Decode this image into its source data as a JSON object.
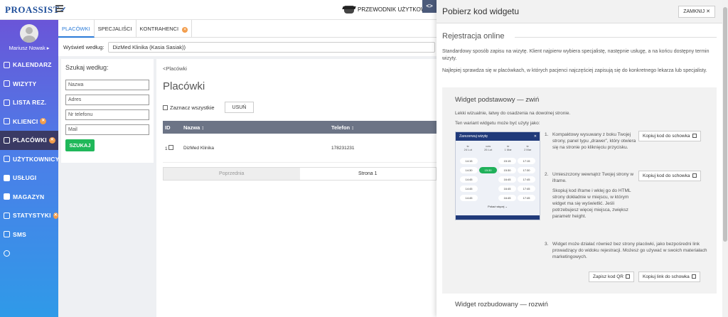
{
  "app": {
    "logo": "PROASSIST"
  },
  "topbar": {
    "guide_label": "PRZEWODNIK UŻYTKOWN"
  },
  "user": {
    "name": "Mariusz Nowak ▸"
  },
  "sidebar": {
    "items": [
      {
        "label": "KALENDARZ",
        "icon": "calendar-icon",
        "badge": ""
      },
      {
        "label": "WIZYTY",
        "icon": "list-icon",
        "badge": ""
      },
      {
        "label": "LISTA REZ.",
        "icon": "list-icon",
        "badge": ""
      },
      {
        "label": "KLIENCI",
        "icon": "clients-icon",
        "badge": "✕"
      },
      {
        "label": "PLACÓWKI",
        "icon": "building-icon",
        "badge": "✕"
      },
      {
        "label": "UŻYTKOWNICY",
        "icon": "user-icon",
        "badge": ""
      },
      {
        "label": "USŁUGI",
        "icon": "grid-icon",
        "badge": ""
      },
      {
        "label": "MAGAZYN",
        "icon": "box-icon",
        "badge": ""
      },
      {
        "label": "STATYSTYKI",
        "icon": "chart-icon",
        "badge": "✕"
      },
      {
        "label": "SMS",
        "icon": "message-icon",
        "badge": ""
      },
      {
        "label": "",
        "icon": "chevron-down-circle-icon",
        "badge": ""
      }
    ]
  },
  "tabs": [
    {
      "label": "PLACÓWKI"
    },
    {
      "label": "SPECJALIŚCI"
    },
    {
      "label": "KONTRAHENCI",
      "badge": "✕"
    }
  ],
  "filter": {
    "label": "Wyświetl według:",
    "value": "DizMed Klinika (Kasia Sasiak))"
  },
  "search": {
    "title": "Szukaj według:",
    "fields": [
      "Nazwa",
      "Adres",
      "Nr telefonu",
      "Mail"
    ],
    "button": "SZUKAJ"
  },
  "list": {
    "breadcrumb": "<Placówki",
    "title": "Placówki",
    "select_all": "Zaznacz wszystkie",
    "delete": "USUŃ",
    "columns": [
      "ID",
      "Nazwa ↕",
      "Telefon ↕"
    ],
    "rows": [
      {
        "id": "1",
        "name": "DizMed Klinika",
        "phone": "178231231"
      }
    ],
    "pager": {
      "prev": "Poprzednia",
      "page": "Strona 1"
    }
  },
  "toggle": "<>",
  "drawer": {
    "title": "Pobierz kod widgetu",
    "close": "ZAMKNIJ ✕",
    "section": "Rejestracja online",
    "intro1": "Standardowy sposób zapisu na wizytę. Klient najpierw wybiera specjalistę, następnie usługę, a na końcu dostępny termin wizyty.",
    "intro2": "Najlepiej sprawdza się w placówkach, w których pacjenci najczęściej zapisują się do konkretnego lekarza lub specjalisty.",
    "card": {
      "title": "Widget podstawowy — zwiń",
      "desc1": "Lekki wizualnie, łatwy do osadzenia na dowolnej stronie.",
      "desc2": "Ten wariant widgetu może być użyty jako:",
      "mock": {
        "header": "Zarezerwuj wizytę",
        "close": "✕",
        "days": [
          [
            "śr",
            "24 Lut"
          ],
          [
            "czw",
            "26 Lut"
          ],
          [
            "śr",
            "1 Mar"
          ],
          [
            "śr",
            "2 Mar"
          ]
        ],
        "slots": [
          "14:15",
          "",
          "15:15",
          "17:15",
          "14:30",
          "",
          "15:30",
          "17:30",
          "14:45",
          "",
          "16:45",
          "17:45",
          "14:45",
          "",
          "16:45",
          "17:45",
          "14:45",
          "",
          "16:45",
          "17:45"
        ],
        "selected_slot": "15:30",
        "more": "Pokaż więcej ⌄"
      },
      "steps": [
        {
          "num": "1.",
          "text": "Kompaktowy wysuwany z boku Twojej strony, panel typu „drawer”, który otwiera się na stronie po kliknięciu przycisku.",
          "button": "Kopiuj kod do schowka"
        },
        {
          "num": "2.",
          "text": "Umieszczony wewnątrz Twojej strony w iframe.",
          "text2": "Skopiuj kod iframe i wklej go do HTML strony dokładnie w miejscu, w którym widget ma się wyświetlić. Jeśli potrzebujesz więcej miejsca, zwiększ parametr height.",
          "button": "Kopiuj kod do schowka"
        },
        {
          "num": "3.",
          "text": "Widget może działać również bez strony placówki, jako bezpośredni link prowadzący do widoku rejestracji. Możesz go używać w swoich materiałach marketingowych."
        }
      ],
      "qr_button": "Zapisz kod QR",
      "link_button": "Kopiuj link do schowka"
    },
    "collapsed_card": "Widget rozbudowany — rozwiń"
  }
}
